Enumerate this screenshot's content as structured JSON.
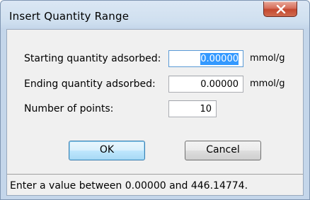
{
  "window": {
    "title": "Insert Quantity Range"
  },
  "form": {
    "starting": {
      "label": "Starting quantity adsorbed:",
      "value": "0.00000",
      "unit": "mmol/g"
    },
    "ending": {
      "label": "Ending quantity adsorbed:",
      "value": "0.00000",
      "unit": "mmol/g"
    },
    "points": {
      "label": "Number of points:",
      "value": "10"
    }
  },
  "buttons": {
    "ok_label": "OK",
    "cancel_label": "Cancel"
  },
  "status": {
    "text": "Enter a value between 0.00000 and 446.14774."
  },
  "icons": {
    "close": "close-icon"
  },
  "colors": {
    "selection": "#3399ff",
    "close_button": "#c4482f",
    "default_button": "#3c7fb1"
  }
}
